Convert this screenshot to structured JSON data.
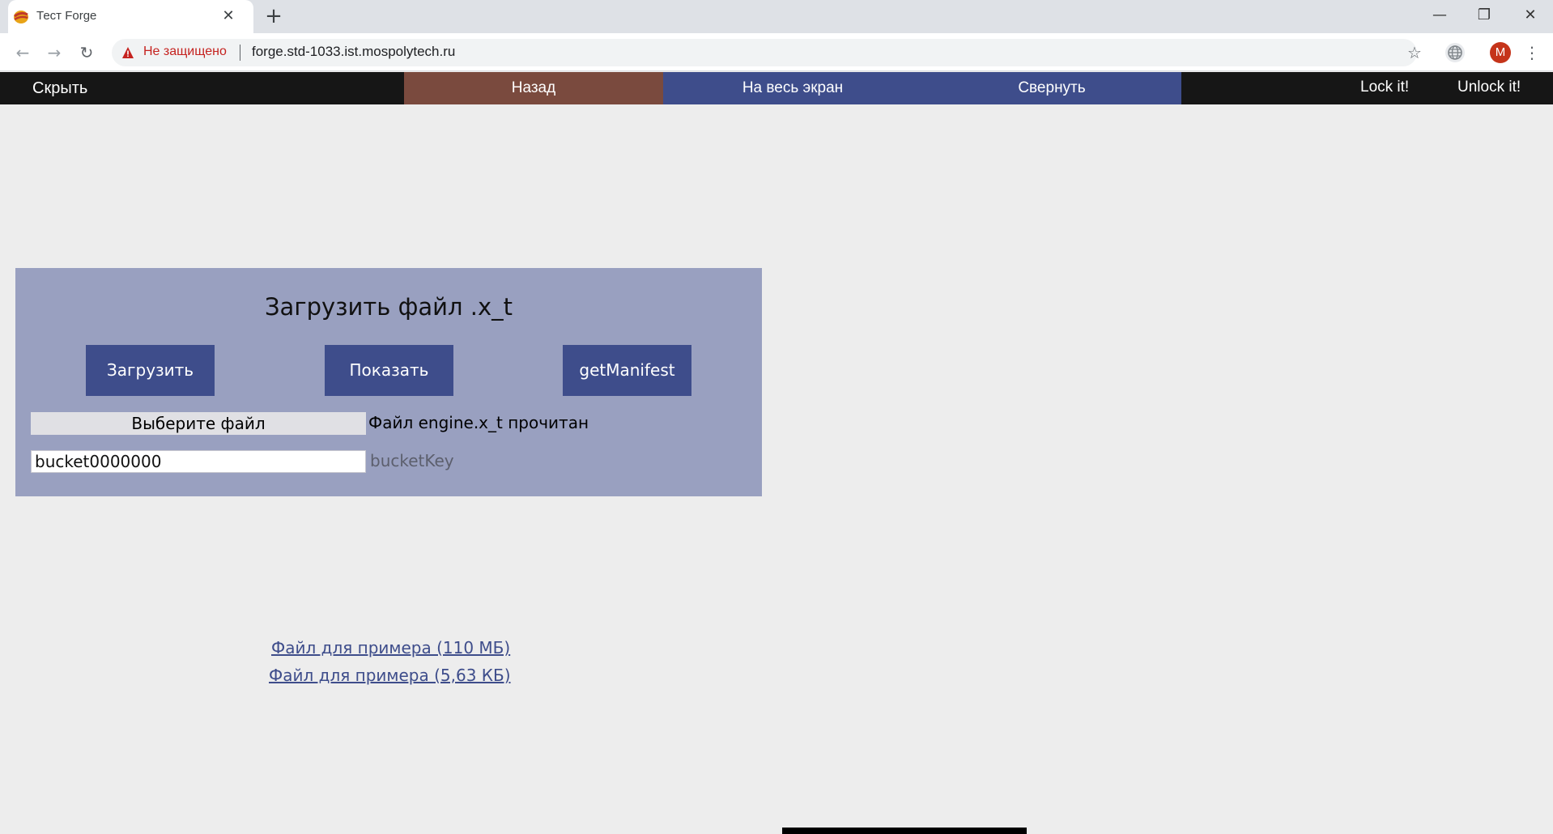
{
  "browser": {
    "tab_title": "Тест Forge",
    "tab_close": "✕",
    "new_tab": "+",
    "window_controls": {
      "minimize": "—",
      "restore": "❐",
      "close": "✕"
    },
    "nav": {
      "back": "←",
      "forward": "→",
      "reload": "↻"
    },
    "security_text": "Не защищено",
    "url": "forge.std-1033.ist.mospolytech.ru",
    "star": "☆",
    "avatar_letter": "M",
    "menu": "⋮"
  },
  "appbar": {
    "hide": "Скрыть",
    "back": "Назад",
    "fullscreen": "На весь экран",
    "collapse": "Свернуть",
    "lock": "Lock it!",
    "unlock": "Unlock it!"
  },
  "panel": {
    "title": "Загрузить файл .x_t",
    "upload": "Загрузить",
    "show": "Показать",
    "manifest": "getManifest",
    "choose_file": "Выберите файл",
    "file_status": "Файл engine.x_t прочитан",
    "bucket_value": "bucket0000000",
    "bucket_label": "bucketKey"
  },
  "links": {
    "sample_large": "Файл для примера (110 МБ)",
    "sample_small": "Файл для примера (5,63 КБ)"
  },
  "colors": {
    "panel_bg": "#99a0c0",
    "button_bg": "#3e4d8b",
    "back_bg": "#7a4a3e",
    "appbar_bg": "#161616",
    "warning": "#c5221f"
  }
}
